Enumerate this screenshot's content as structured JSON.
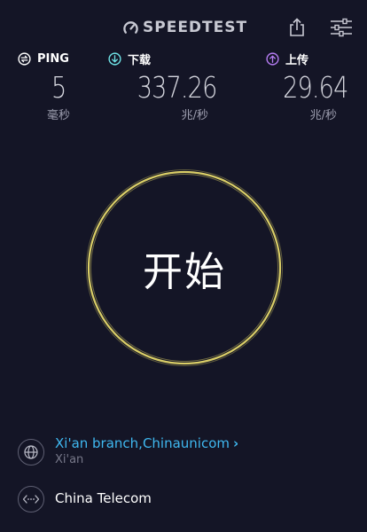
{
  "header": {
    "brand_name": "SPEEDTEST",
    "logo_icon": "speedometer-icon",
    "share_icon": "share-icon",
    "settings_icon": "sliders-icon"
  },
  "metrics": {
    "ping": {
      "label": "PING",
      "value": "5",
      "unit": "毫秒",
      "icon": "ping-icon",
      "color": "#ffffff"
    },
    "download": {
      "label": "下载",
      "value": "337.26",
      "unit": "兆/秒",
      "icon": "download-arrow-icon",
      "color": "#6fe3e6"
    },
    "upload": {
      "label": "上传",
      "value": "29.64",
      "unit": "兆/秒",
      "icon": "upload-arrow-icon",
      "color": "#b57cf2"
    }
  },
  "start_button": {
    "label": "开始",
    "ring_color": "#e6d96a"
  },
  "server": {
    "name": "Xi'an branch,Chinaunicom",
    "location": "Xi'an",
    "icon": "globe-icon",
    "name_color": "#3fb8f0"
  },
  "isp": {
    "name": "China Telecom",
    "icon": "connection-icon"
  }
}
